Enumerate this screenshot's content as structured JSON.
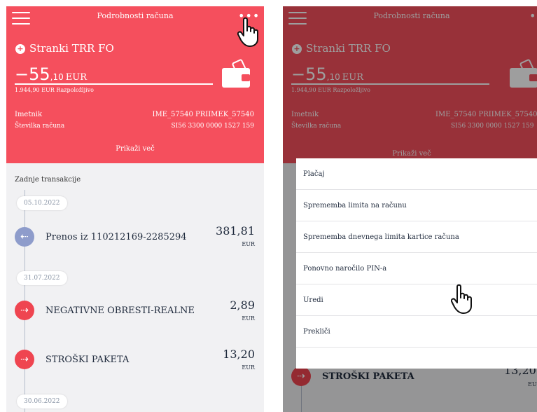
{
  "header": {
    "title": "Podrobnosti računa",
    "more_icon": "more-dots-icon",
    "menu_icon": "hamburger-menu-icon"
  },
  "account": {
    "name": "Stranki TRR FO",
    "balance_int": "−55",
    "balance_dec": ",10",
    "currency": "EUR",
    "available": "1.944,90 EUR Razpoložljivo",
    "owner_label": "Imetnik",
    "owner_value": "IME_57540 PRIIMEK_57540",
    "number_label": "Številka računa",
    "number_value": "SI56 3300 0000 1527 159",
    "show_more": "Prikaži več"
  },
  "transactions": {
    "title": "Zadnje transakcije",
    "groups": [
      {
        "date": "05.10.2022",
        "items": [
          {
            "desc": "Prenos iz 110212169-2285294",
            "amount": "381,81",
            "currency": "EUR",
            "direction": "in"
          }
        ]
      },
      {
        "date": "31.07.2022",
        "items": [
          {
            "desc": "NEGATIVNE OBRESTI-REALNE",
            "amount": "2,89",
            "currency": "EUR",
            "direction": "out"
          },
          {
            "desc": "STROŠKI PAKETA",
            "amount": "13,20",
            "currency": "EUR",
            "direction": "out"
          }
        ]
      },
      {
        "date": "30.06.2022",
        "items": []
      }
    ]
  },
  "context_menu": {
    "items": [
      "Plačaj",
      "Sprememba limita na računu",
      "Sprememba dnevnega limita kartice računa",
      "Ponovno naročilo PIN-a",
      "Uredi",
      "Prekliči"
    ]
  },
  "colors": {
    "brand_red": "#f54f5d",
    "incoming_icon": "#8e9ccb",
    "outgoing_icon": "#ef4550"
  }
}
